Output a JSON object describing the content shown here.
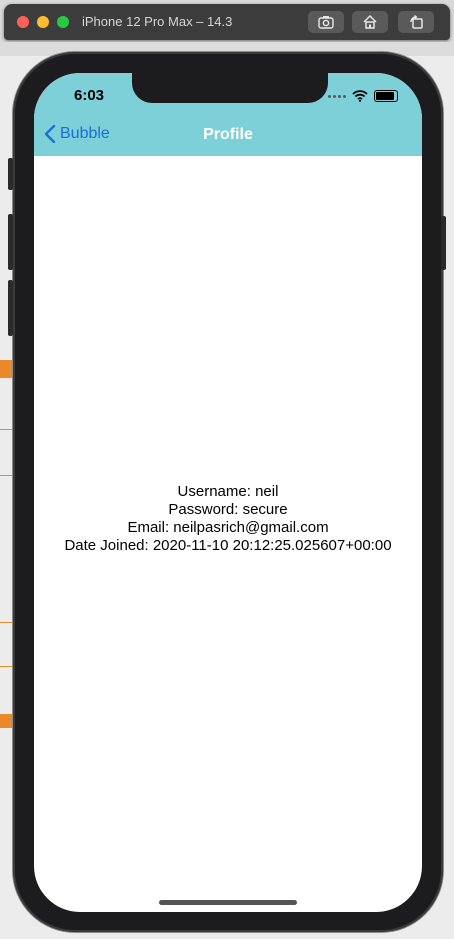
{
  "window": {
    "title": "iPhone 12 Pro Max – 14.3",
    "toolbar": {
      "screenshot_icon": "camera-icon",
      "home_icon": "home-icon",
      "rotate_icon": "rotate-icon"
    }
  },
  "status_bar": {
    "time": "6:03"
  },
  "nav": {
    "back_label": "Bubble",
    "title": "Profile"
  },
  "profile": {
    "username": "Username: neil",
    "password": "Password: secure",
    "email": "Email: neilpasrich@gmail.com",
    "date_joined": "Date Joined: 2020-11-10 20:12:25.025607+00:00"
  },
  "colors": {
    "nav_bar": "#7dcfd8",
    "back_tint": "#1a6fd6",
    "title_text": "#ffffff"
  }
}
